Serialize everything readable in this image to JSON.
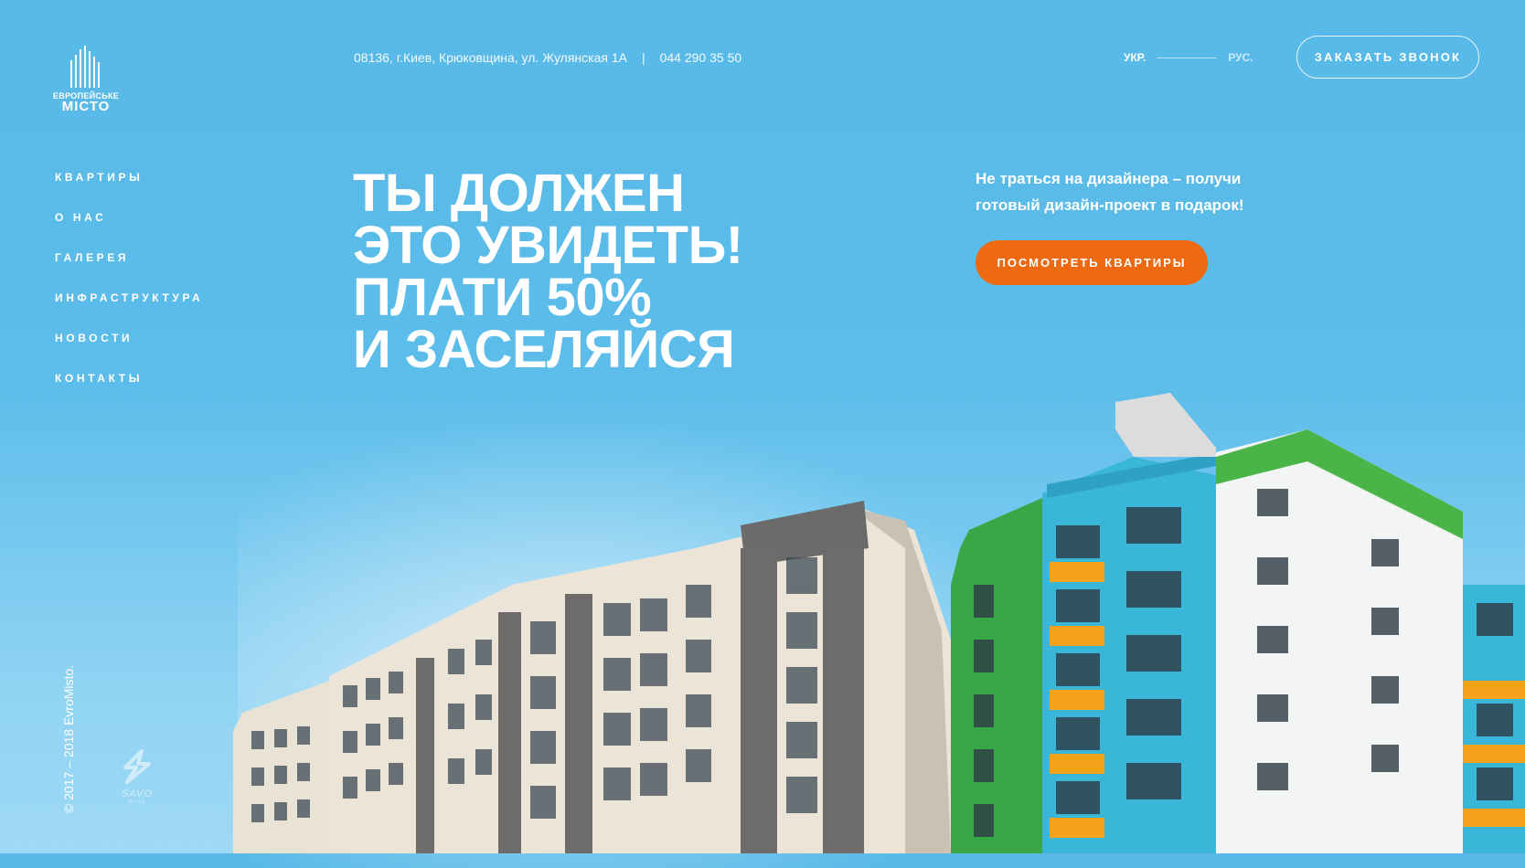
{
  "logo": {
    "line1": "ЕВРОПЕЙСЬКЕ",
    "line2": "МІСТО"
  },
  "header": {
    "address": "08136, г.Киев, Крюковщина, ул. Жулянская 1А",
    "separator": "|",
    "phone": "044 290 35 50",
    "lang_active": "УКР.",
    "lang_inactive": "РУС.",
    "call_button": "ЗАКАЗАТЬ ЗВОНОК"
  },
  "nav": {
    "items": [
      {
        "label": "КВАРТИРЫ"
      },
      {
        "label": "О НАС"
      },
      {
        "label": "ГАЛЕРЕЯ"
      },
      {
        "label": "ИНФРАСТРУКТУРА"
      },
      {
        "label": "НОВОСТИ"
      },
      {
        "label": "КОНТАКТЫ"
      }
    ]
  },
  "hero": {
    "lines": [
      "ТЫ ДОЛЖЕН",
      "ЭТО УВИДЕТЬ!",
      "ПЛАТИ 50%",
      "И ЗАСЕЛЯЙСЯ"
    ]
  },
  "promo": {
    "line1": "Не трать­ся на ди­зай­не­ра – по­лу­чи",
    "line2": "готовый дизайн-проект в подарок!",
    "button": "ПОСМОТРЕТЬ КВАРТИРЫ"
  },
  "footer": {
    "copyright": "© 2017 – 2018 EvroMisto.",
    "partner_name": "SAVO",
    "partner_sub": "Group"
  },
  "colors": {
    "background": "#58b9e8",
    "accent_orange": "#ee6a12",
    "text": "#ffffff"
  }
}
